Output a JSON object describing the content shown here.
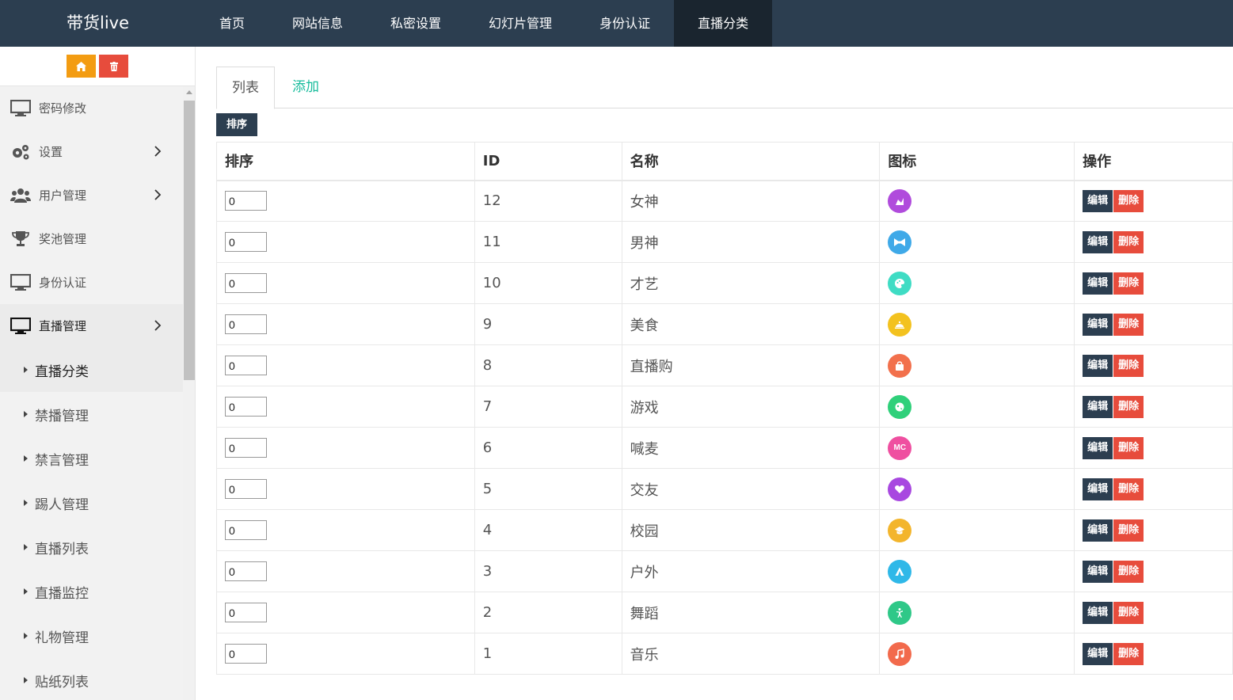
{
  "brand": "带货live",
  "topnav": [
    "首页",
    "网站信息",
    "私密设置",
    "幻灯片管理",
    "身份认证",
    "直播分类"
  ],
  "topnav_active": 5,
  "sidebar": {
    "menu": [
      {
        "label": "密码修改",
        "icon": "monitor-icon",
        "arrow": false
      },
      {
        "label": "设置",
        "icon": "gears-icon",
        "arrow": true
      },
      {
        "label": "用户管理",
        "icon": "users-icon",
        "arrow": true
      },
      {
        "label": "奖池管理",
        "icon": "trophy-icon",
        "arrow": false
      },
      {
        "label": "身份认证",
        "icon": "monitor-icon",
        "arrow": false
      },
      {
        "label": "直播管理",
        "icon": "monitor-icon",
        "arrow": true
      }
    ],
    "submenu": [
      "直播分类",
      "禁播管理",
      "禁言管理",
      "踢人管理",
      "直播列表",
      "直播监控",
      "礼物管理",
      "贴纸列表"
    ]
  },
  "tabs": {
    "list": "列表",
    "add": "添加"
  },
  "sort_button": "排序",
  "table": {
    "headers": [
      "排序",
      "ID",
      "名称",
      "图标",
      "操作"
    ],
    "edit_label": "编辑",
    "delete_label": "删除",
    "rows": [
      {
        "sort": "0",
        "id": "12",
        "name": "女神",
        "icon": "heels-icon",
        "color": "#b04bdc"
      },
      {
        "sort": "0",
        "id": "11",
        "name": "男神",
        "icon": "bowtie-icon",
        "color": "#3fa9e8"
      },
      {
        "sort": "0",
        "id": "10",
        "name": "才艺",
        "icon": "palette-icon",
        "color": "#3fdcc4"
      },
      {
        "sort": "0",
        "id": "9",
        "name": "美食",
        "icon": "dish-icon",
        "color": "#f3c21f"
      },
      {
        "sort": "0",
        "id": "8",
        "name": "直播购",
        "icon": "bag-icon",
        "color": "#f2704c"
      },
      {
        "sort": "0",
        "id": "7",
        "name": "游戏",
        "icon": "gamepad-icon",
        "color": "#2fd07a"
      },
      {
        "sort": "0",
        "id": "6",
        "name": "喊麦",
        "icon": "mc-icon",
        "color": "#ef4fa0"
      },
      {
        "sort": "0",
        "id": "5",
        "name": "交友",
        "icon": "heart-icon",
        "color": "#a848e0"
      },
      {
        "sort": "0",
        "id": "4",
        "name": "校园",
        "icon": "graduation-cap-icon",
        "color": "#f3b52c"
      },
      {
        "sort": "0",
        "id": "3",
        "name": "户外",
        "icon": "tent-icon",
        "color": "#2fb8e8"
      },
      {
        "sort": "0",
        "id": "2",
        "name": "舞蹈",
        "icon": "dancer-icon",
        "color": "#2fc888"
      },
      {
        "sort": "0",
        "id": "1",
        "name": "音乐",
        "icon": "music-note-icon",
        "color": "#f26a4c"
      }
    ]
  }
}
